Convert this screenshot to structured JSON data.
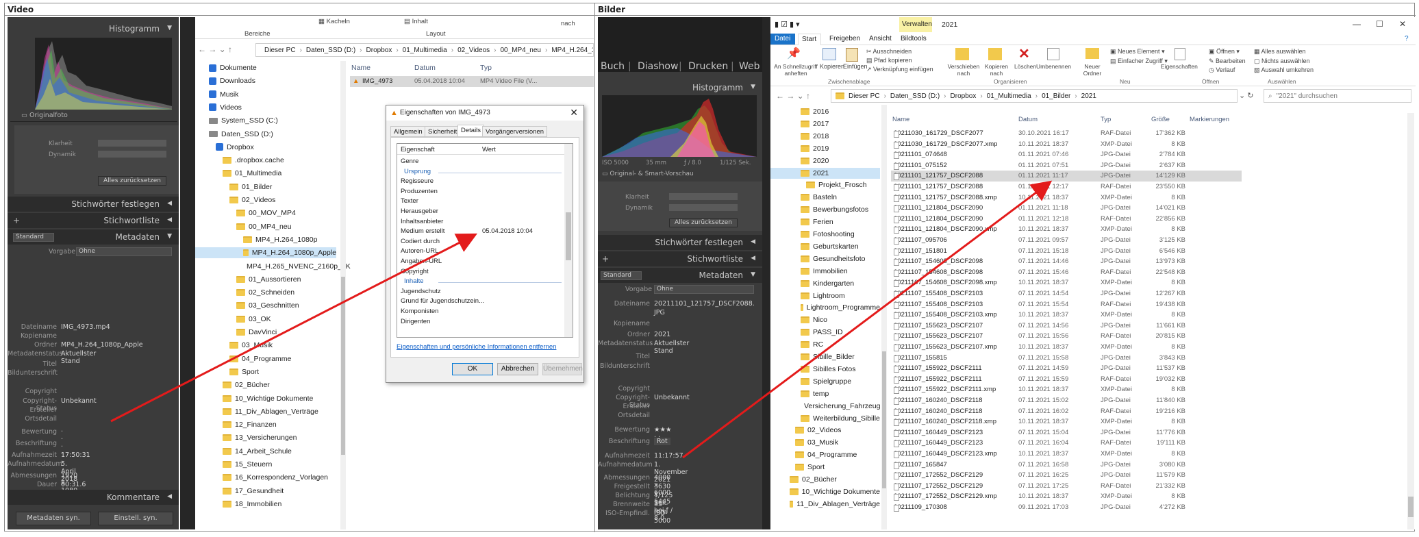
{
  "sections": {
    "left_title": "Video",
    "right_title": "Bilder"
  },
  "left": {
    "histogram_title": "Histogramm",
    "originalfoto": "Originalfoto",
    "klarheit": "Klarheit",
    "dynamik": "Dynamik",
    "alles_zuruecksetzen": "Alles zurücksetzen",
    "stichwoerter_festlegen": "Stichwörter festlegen",
    "stichwortliste": "Stichwortliste",
    "standard": "Standard",
    "metadaten": "Metadaten",
    "vorgabe_label": "Vorgabe",
    "vorgabe_value": "Ohne",
    "fields": [
      {
        "k": "Dateiname",
        "v": "IMG_4973.mp4"
      },
      {
        "k": "Kopiename",
        "v": ""
      },
      {
        "k": "Ordner",
        "v": "MP4_H.264_1080p_Apple"
      },
      {
        "k": "Metadatenstatus",
        "v": "Aktuellster Stand"
      },
      {
        "k": "Titel",
        "v": ""
      },
      {
        "k": "Bildunterschrift",
        "v": ""
      },
      {
        "k": "Copyright",
        "v": ""
      },
      {
        "k": "Copyright-Status",
        "v": "Unbekannt"
      },
      {
        "k": "Ersteller",
        "v": ""
      },
      {
        "k": "Ortsdetail",
        "v": ""
      },
      {
        "k": "Bewertung",
        "v": "· · · · ·"
      },
      {
        "k": "Beschriftung",
        "v": ""
      },
      {
        "k": "Aufnahmezeit",
        "v": "17:50:31"
      },
      {
        "k": "Aufnahmedatum",
        "v": "5. April 2018"
      },
      {
        "k": "Abmessungen",
        "v": "1920 x 1080"
      },
      {
        "k": "Dauer",
        "v": "00:31.6"
      },
      {
        "k": "GPS",
        "v": ""
      }
    ],
    "kommentare": "Kommentare",
    "metadaten_syn": "Metadaten syn.",
    "einstell_syn": "Einstell. syn.",
    "ribbon": {
      "kacheln": "Kacheln",
      "inhalt": "Inhalt",
      "bereiche": "Bereiche",
      "layout": "Layout",
      "nach": "nach"
    },
    "address": [
      "Dieser PC",
      "Daten_SSD (D:)",
      "Dropbox",
      "01_Multimedia",
      "02_Videos",
      "00_MP4_neu",
      "MP4_H.264_10"
    ],
    "nav": [
      {
        "label": "Dokumente",
        "type": "doc",
        "indent": 0
      },
      {
        "label": "Downloads",
        "type": "dl",
        "indent": 0
      },
      {
        "label": "Musik",
        "type": "music",
        "indent": 0
      },
      {
        "label": "Videos",
        "type": "vid",
        "indent": 0
      },
      {
        "label": "System_SSD (C:)",
        "type": "drive",
        "indent": 0
      },
      {
        "label": "Daten_SSD (D:)",
        "type": "drive",
        "indent": 0
      },
      {
        "label": "Dropbox",
        "type": "dropbox",
        "indent": 1
      },
      {
        "label": ".dropbox.cache",
        "type": "folder",
        "indent": 2
      },
      {
        "label": "01_Multimedia",
        "type": "folder",
        "indent": 2
      },
      {
        "label": "01_Bilder",
        "type": "folder",
        "indent": 3
      },
      {
        "label": "02_Videos",
        "type": "folder",
        "indent": 3
      },
      {
        "label": "00_MOV_MP4",
        "type": "folder",
        "indent": 4
      },
      {
        "label": "00_MP4_neu",
        "type": "folder",
        "indent": 4
      },
      {
        "label": "MP4_H.264_1080p",
        "type": "folder",
        "indent": 5
      },
      {
        "label": "MP4_H.264_1080p_Apple",
        "type": "folder",
        "indent": 5,
        "selected": true
      },
      {
        "label": "MP4_H.265_NVENC_2160p_4K",
        "type": "folder",
        "indent": 5
      },
      {
        "label": "01_Aussortieren",
        "type": "folder",
        "indent": 4
      },
      {
        "label": "02_Schneiden",
        "type": "folder",
        "indent": 4
      },
      {
        "label": "03_Geschnitten",
        "type": "folder",
        "indent": 4
      },
      {
        "label": "03_OK",
        "type": "folder",
        "indent": 4
      },
      {
        "label": "DavVinci",
        "type": "folder",
        "indent": 4
      },
      {
        "label": "03_Musik",
        "type": "folder",
        "indent": 3
      },
      {
        "label": "04_Programme",
        "type": "folder",
        "indent": 3
      },
      {
        "label": "Sport",
        "type": "folder",
        "indent": 3
      },
      {
        "label": "02_Bücher",
        "type": "folder",
        "indent": 2
      },
      {
        "label": "10_Wichtige Dokumente",
        "type": "folder",
        "indent": 2
      },
      {
        "label": "11_Div_Ablagen_Verträge",
        "type": "folder",
        "indent": 2
      },
      {
        "label": "12_Finanzen",
        "type": "folder",
        "indent": 2
      },
      {
        "label": "13_Versicherungen",
        "type": "folder",
        "indent": 2
      },
      {
        "label": "14_Arbeit_Schule",
        "type": "folder",
        "indent": 2
      },
      {
        "label": "15_Steuern",
        "type": "folder",
        "indent": 2
      },
      {
        "label": "16_Korrespondenz_Vorlagen",
        "type": "folder",
        "indent": 2
      },
      {
        "label": "17_Gesundheit",
        "type": "folder",
        "indent": 2
      },
      {
        "label": "18_Immobilien",
        "type": "folder",
        "indent": 2
      }
    ],
    "list_headers": [
      "Name",
      "Datum",
      "Typ"
    ],
    "file": {
      "name": "IMG_4973",
      "date": "05.04.2018 10:04",
      "type": "MP4 Video File (V..."
    },
    "dialog": {
      "title": "Eigenschaften von IMG_4973",
      "tabs": [
        "Allgemein",
        "Sicherheit",
        "Details",
        "Vorgängerversionen"
      ],
      "col_prop": "Eigenschaft",
      "col_val": "Wert",
      "rows": [
        {
          "t": "Genre",
          "v": ""
        },
        {
          "t": "§Ursprung",
          "v": ""
        },
        {
          "t": "Regisseure",
          "v": ""
        },
        {
          "t": "Produzenten",
          "v": ""
        },
        {
          "t": "Texter",
          "v": ""
        },
        {
          "t": "Herausgeber",
          "v": ""
        },
        {
          "t": "Inhaltsanbieter",
          "v": ""
        },
        {
          "t": "Medium erstellt",
          "v": "05.04.2018 10:04"
        },
        {
          "t": "Codiert durch",
          "v": ""
        },
        {
          "t": "Autoren-URL",
          "v": ""
        },
        {
          "t": "Angaben-URL",
          "v": ""
        },
        {
          "t": "Copyright",
          "v": ""
        },
        {
          "t": "§Inhalte",
          "v": ""
        },
        {
          "t": "Jugendschutz",
          "v": ""
        },
        {
          "t": "Grund für Jugendschutzein...",
          "v": ""
        },
        {
          "t": "Komponisten",
          "v": ""
        },
        {
          "t": "Dirigenten",
          "v": ""
        }
      ],
      "link": "Eigenschaften und persönliche Informationen entfernen",
      "ok": "OK",
      "cancel": "Abbrechen",
      "apply": "Übernehmen"
    }
  },
  "right": {
    "lr_nav": [
      "Buch",
      "Diashow",
      "Drucken",
      "Web"
    ],
    "histogram_title": "Histogramm",
    "exif": [
      "ISO 5000",
      "35 mm",
      "ƒ / 8.0",
      "1/125 Sek."
    ],
    "original_vorschau": "Original- & Smart-Vorschau",
    "klarheit": "Klarheit",
    "dynamik": "Dynamik",
    "alles_zuruecksetzen": "Alles zurücksetzen",
    "stichwoerter_festlegen": "Stichwörter festlegen",
    "stichwortliste": "Stichwortliste",
    "standard": "Standard",
    "metadaten": "Metadaten",
    "vorgabe_label": "Vorgabe",
    "vorgabe_value": "Ohne",
    "fields": [
      {
        "k": "Dateiname",
        "v": "20211101_121757_DSCF2088."
      },
      {
        "k": "",
        "v": "JPG"
      },
      {
        "k": "Kopiename",
        "v": ""
      },
      {
        "k": "Ordner",
        "v": "2021"
      },
      {
        "k": "Metadatenstatus",
        "v": "Aktuellster Stand"
      },
      {
        "k": "Titel",
        "v": ""
      },
      {
        "k": "Bildunterschrift",
        "v": ""
      },
      {
        "k": "Copyright",
        "v": ""
      },
      {
        "k": "Copyright-Status",
        "v": "Unbekannt"
      },
      {
        "k": "Ersteller",
        "v": ""
      },
      {
        "k": "Ortsdetail",
        "v": ""
      },
      {
        "k": "Bewertung",
        "v": "★★★ · ·"
      },
      {
        "k": "Beschriftung",
        "v": "Rot"
      },
      {
        "k": "Aufnahmezeit",
        "v": "11:17:57"
      },
      {
        "k": "Aufnahmedatum",
        "v": "1. November 2021"
      },
      {
        "k": "Abmessungen",
        "v": "4000 x 6000"
      },
      {
        "k": "Freigestellt",
        "v": "3630 x 5445"
      },
      {
        "k": "Belichtung",
        "v": "1/125 Sek. bei ƒ / 8.0"
      },
      {
        "k": "Brennweite",
        "v": "35 mm"
      },
      {
        "k": "ISO-Empfindl.",
        "v": "ISO 5000"
      }
    ],
    "window_title": "2021",
    "verwalten": "Verwalten",
    "ribbon_tabs": [
      "Datei",
      "Start",
      "Freigeben",
      "Ansicht",
      "Bildtools"
    ],
    "ribbon": {
      "schnellzugriff": "An Schnellzugriff anheften",
      "kopieren": "Kopieren",
      "einfuegen": "Einfügen",
      "ausschneiden": "Ausschneiden",
      "pfad_kopieren": "Pfad kopieren",
      "verknuepfung": "Verknüpfung einfügen",
      "zwischenablage": "Zwischenablage",
      "verschieben": "Verschieben nach",
      "kopieren_nach": "Kopieren nach",
      "loeschen": "Löschen",
      "umbenennen": "Umbenennen",
      "organisieren": "Organisieren",
      "neuer_ordner": "Neuer Ordner",
      "neues_element": "Neues Element",
      "einfacher_zugriff": "Einfacher Zugriff",
      "neu": "Neu",
      "eigenschaften": "Eigenschaften",
      "oeffnen": "Öffnen",
      "bearbeiten": "Bearbeiten",
      "verlauf": "Verlauf",
      "oeffnen_group": "Öffnen",
      "alles_auswaehlen": "Alles auswählen",
      "nichts_auswaehlen": "Nichts auswählen",
      "auswahl_umkehren": "Auswahl umkehren",
      "auswaehlen": "Auswählen"
    },
    "address": [
      "Dieser PC",
      "Daten_SSD (D:)",
      "Dropbox",
      "01_Multimedia",
      "01_Bilder",
      "2021"
    ],
    "search_placeholder": "\"2021\" durchsuchen",
    "nav": [
      {
        "label": "2016",
        "indent": 0
      },
      {
        "label": "2017",
        "indent": 0
      },
      {
        "label": "2018",
        "indent": 0
      },
      {
        "label": "2019",
        "indent": 0
      },
      {
        "label": "2020",
        "indent": 0
      },
      {
        "label": "2021",
        "indent": 0,
        "selected": true
      },
      {
        "label": "Projekt_Frosch",
        "indent": 1
      },
      {
        "label": "Basteln",
        "indent": 0
      },
      {
        "label": "Bewerbungsfotos",
        "indent": 0
      },
      {
        "label": "Ferien",
        "indent": 0
      },
      {
        "label": "Fotoshooting",
        "indent": 0
      },
      {
        "label": "Geburtskarten",
        "indent": 0
      },
      {
        "label": "Gesundheitsfoto",
        "indent": 0
      },
      {
        "label": "Immobilien",
        "indent": 0
      },
      {
        "label": "Kindergarten",
        "indent": 0
      },
      {
        "label": "Lightroom",
        "indent": 0
      },
      {
        "label": "Lightroom_Programme",
        "indent": 0
      },
      {
        "label": "Nico",
        "indent": 0
      },
      {
        "label": "PASS_ID",
        "indent": 0
      },
      {
        "label": "RC",
        "indent": 0
      },
      {
        "label": "Sibille_Bilder",
        "indent": 0
      },
      {
        "label": "Sibilles Fotos",
        "indent": 0
      },
      {
        "label": "Spielgruppe",
        "indent": 0
      },
      {
        "label": "temp",
        "indent": 0
      },
      {
        "label": "Versicherung_Fahrzeug",
        "indent": 0
      },
      {
        "label": "Weiterbildung_Sibille",
        "indent": 0
      },
      {
        "label": "02_Videos",
        "indent": -1
      },
      {
        "label": "03_Musik",
        "indent": -1
      },
      {
        "label": "04_Programme",
        "indent": -1
      },
      {
        "label": "Sport",
        "indent": -1
      },
      {
        "label": "02_Bücher",
        "indent": -2
      },
      {
        "label": "10_Wichtige Dokumente",
        "indent": -2
      },
      {
        "label": "11_Div_Ablagen_Verträge",
        "indent": -2
      }
    ],
    "list_headers": [
      "Name",
      "Datum",
      "Typ",
      "Größe",
      "Markierungen"
    ],
    "files": [
      {
        "n": "20211030_161729_DSCF2077",
        "d": "30.10.2021 16:17",
        "t": "RAF-Datei",
        "s": "17'362 KB"
      },
      {
        "n": "20211030_161729_DSCF2077.xmp",
        "d": "10.11.2021 18:37",
        "t": "XMP-Datei",
        "s": "8 KB"
      },
      {
        "n": "20211101_074648",
        "d": "01.11.2021 07:46",
        "t": "JPG-Datei",
        "s": "2'784 KB"
      },
      {
        "n": "20211101_075152",
        "d": "01.11.2021 07:51",
        "t": "JPG-Datei",
        "s": "2'637 KB"
      },
      {
        "n": "20211101_121757_DSCF2088",
        "d": "01.11.2021 11:17",
        "t": "JPG-Datei",
        "s": "14'129 KB",
        "sel": true
      },
      {
        "n": "20211101_121757_DSCF2088",
        "d": "01.11.2021 12:17",
        "t": "RAF-Datei",
        "s": "23'550 KB"
      },
      {
        "n": "20211101_121757_DSCF2088.xmp",
        "d": "10.11.2021 18:37",
        "t": "XMP-Datei",
        "s": "8 KB"
      },
      {
        "n": "20211101_121804_DSCF2090",
        "d": "01.11.2021 11:18",
        "t": "JPG-Datei",
        "s": "14'021 KB"
      },
      {
        "n": "20211101_121804_DSCF2090",
        "d": "01.11.2021 12:18",
        "t": "RAF-Datei",
        "s": "22'856 KB"
      },
      {
        "n": "20211101_121804_DSCF2090.xmp",
        "d": "10.11.2021 18:37",
        "t": "XMP-Datei",
        "s": "8 KB"
      },
      {
        "n": "20211107_095706",
        "d": "07.11.2021 09:57",
        "t": "JPG-Datei",
        "s": "3'125 KB"
      },
      {
        "n": "20211107_151801",
        "d": "07.11.2021 15:18",
        "t": "JPG-Datei",
        "s": "6'546 KB"
      },
      {
        "n": "20211107_154608_DSCF2098",
        "d": "07.11.2021 14:46",
        "t": "JPG-Datei",
        "s": "13'973 KB"
      },
      {
        "n": "20211107_154608_DSCF2098",
        "d": "07.11.2021 15:46",
        "t": "RAF-Datei",
        "s": "22'548 KB"
      },
      {
        "n": "20211107_154608_DSCF2098.xmp",
        "d": "10.11.2021 18:37",
        "t": "XMP-Datei",
        "s": "8 KB"
      },
      {
        "n": "20211107_155408_DSCF2103",
        "d": "07.11.2021 14:54",
        "t": "JPG-Datei",
        "s": "12'267 KB"
      },
      {
        "n": "20211107_155408_DSCF2103",
        "d": "07.11.2021 15:54",
        "t": "RAF-Datei",
        "s": "19'438 KB"
      },
      {
        "n": "20211107_155408_DSCF2103.xmp",
        "d": "10.11.2021 18:37",
        "t": "XMP-Datei",
        "s": "8 KB"
      },
      {
        "n": "20211107_155623_DSCF2107",
        "d": "07.11.2021 14:56",
        "t": "JPG-Datei",
        "s": "11'661 KB"
      },
      {
        "n": "20211107_155623_DSCF2107",
        "d": "07.11.2021 15:56",
        "t": "RAF-Datei",
        "s": "20'815 KB"
      },
      {
        "n": "20211107_155623_DSCF2107.xmp",
        "d": "10.11.2021 18:37",
        "t": "XMP-Datei",
        "s": "8 KB"
      },
      {
        "n": "20211107_155815",
        "d": "07.11.2021 15:58",
        "t": "JPG-Datei",
        "s": "3'843 KB"
      },
      {
        "n": "20211107_155922_DSCF2111",
        "d": "07.11.2021 14:59",
        "t": "JPG-Datei",
        "s": "11'537 KB"
      },
      {
        "n": "20211107_155922_DSCF2111",
        "d": "07.11.2021 15:59",
        "t": "RAF-Datei",
        "s": "19'032 KB"
      },
      {
        "n": "20211107_155922_DSCF2111.xmp",
        "d": "10.11.2021 18:37",
        "t": "XMP-Datei",
        "s": "8 KB"
      },
      {
        "n": "20211107_160240_DSCF2118",
        "d": "07.11.2021 15:02",
        "t": "JPG-Datei",
        "s": "11'840 KB"
      },
      {
        "n": "20211107_160240_DSCF2118",
        "d": "07.11.2021 16:02",
        "t": "RAF-Datei",
        "s": "19'216 KB"
      },
      {
        "n": "20211107_160240_DSCF2118.xmp",
        "d": "10.11.2021 18:37",
        "t": "XMP-Datei",
        "s": "8 KB"
      },
      {
        "n": "20211107_160449_DSCF2123",
        "d": "07.11.2021 15:04",
        "t": "JPG-Datei",
        "s": "11'776 KB"
      },
      {
        "n": "20211107_160449_DSCF2123",
        "d": "07.11.2021 16:04",
        "t": "RAF-Datei",
        "s": "19'111 KB"
      },
      {
        "n": "20211107_160449_DSCF2123.xmp",
        "d": "10.11.2021 18:37",
        "t": "XMP-Datei",
        "s": "8 KB"
      },
      {
        "n": "20211107_165847",
        "d": "07.11.2021 16:58",
        "t": "JPG-Datei",
        "s": "3'080 KB"
      },
      {
        "n": "20211107_172552_DSCF2129",
        "d": "07.11.2021 16:25",
        "t": "JPG-Datei",
        "s": "11'579 KB"
      },
      {
        "n": "20211107_172552_DSCF2129",
        "d": "07.11.2021 17:25",
        "t": "RAF-Datei",
        "s": "21'332 KB"
      },
      {
        "n": "20211107_172552_DSCF2129.xmp",
        "d": "10.11.2021 18:37",
        "t": "XMP-Datei",
        "s": "8 KB"
      },
      {
        "n": "20211109_170308",
        "d": "09.11.2021 17:03",
        "t": "JPG-Datei",
        "s": "4'272 KB"
      }
    ]
  },
  "colors": {
    "arrow": "#e31b1b",
    "lr_bg": "#3b3b3b",
    "accent": "#1a73c9"
  }
}
